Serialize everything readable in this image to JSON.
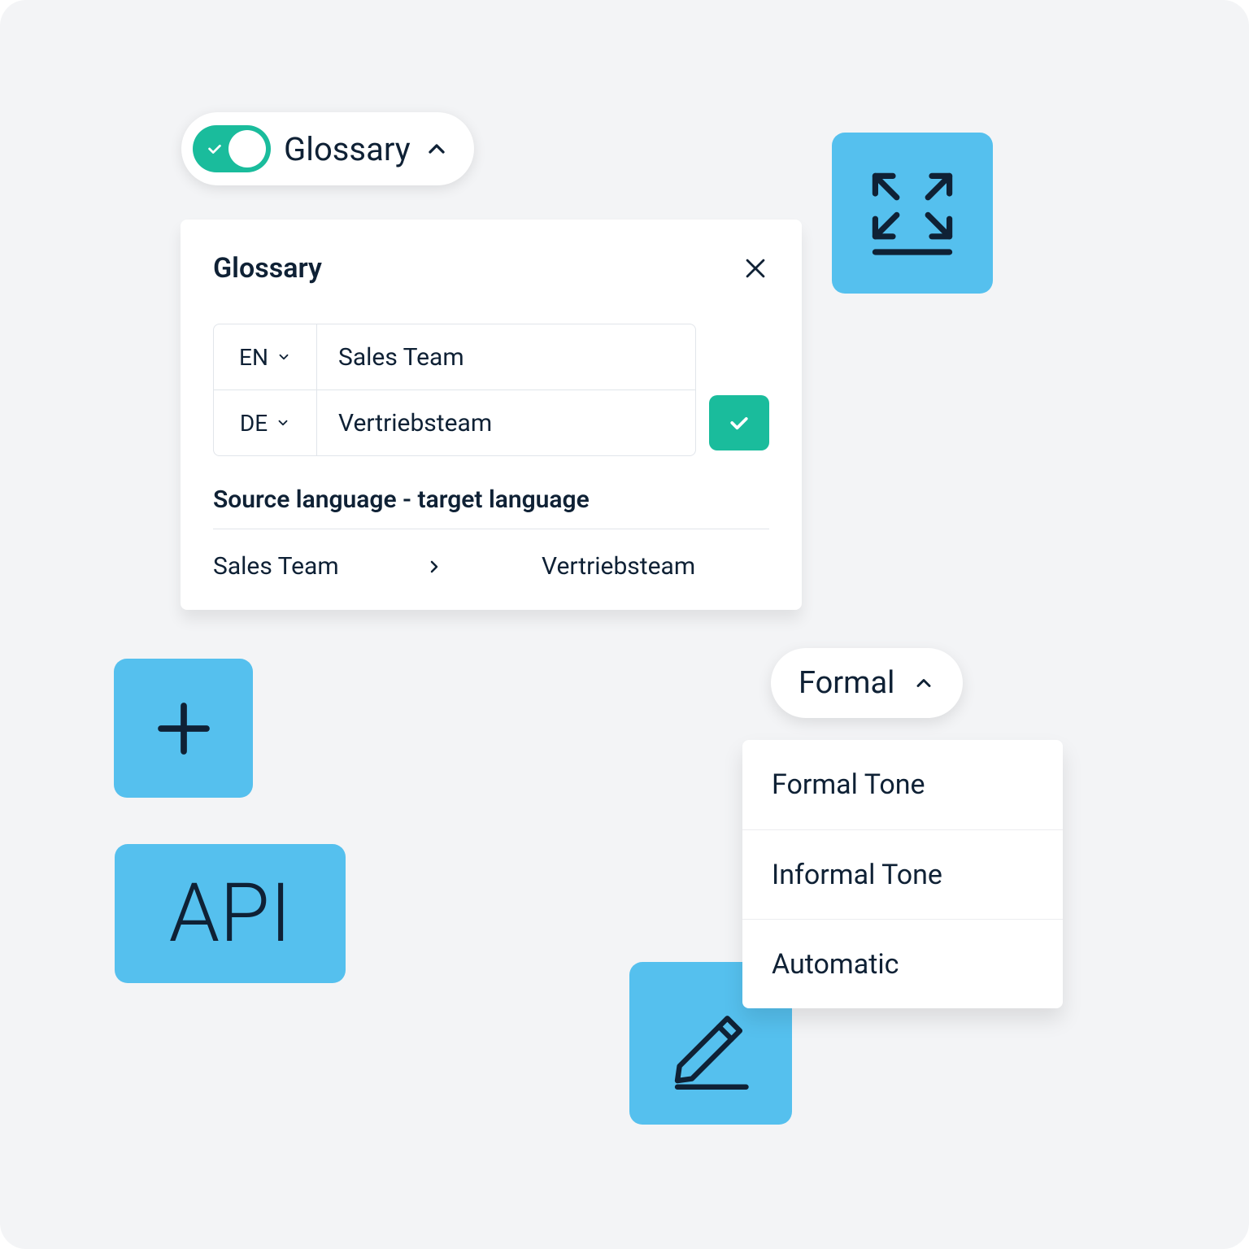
{
  "glossary_toggle": {
    "label": "Glossary",
    "enabled": true
  },
  "glossary_panel": {
    "title": "Glossary",
    "entries": [
      {
        "lang": "EN",
        "term": "Sales Team"
      },
      {
        "lang": "DE",
        "term": "Vertriebsteam"
      }
    ],
    "section_label": "Source language - target language",
    "mapping": {
      "source": "Sales Team",
      "target": "Vertriebsteam"
    }
  },
  "tiles": {
    "api_label": "API"
  },
  "formality": {
    "selected": "Formal",
    "options": [
      "Formal Tone",
      "Informal Tone",
      "Automatic"
    ]
  },
  "colors": {
    "accent_green": "#1abc9c",
    "tile_blue": "#55c0ee",
    "text": "#0f2135"
  }
}
